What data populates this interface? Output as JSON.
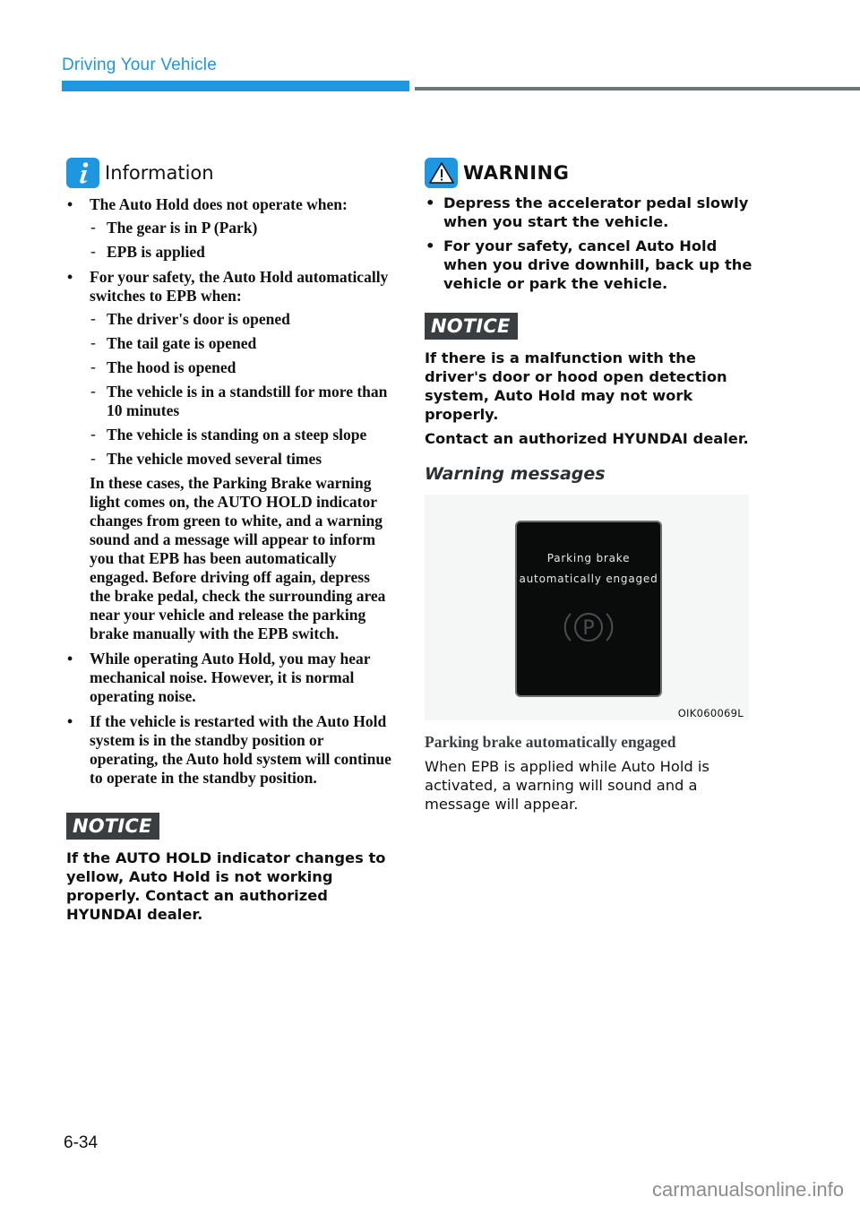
{
  "header": {
    "section_title": "Driving Your Vehicle",
    "accent_color": "#1e96e0",
    "rule_color": "#6d7475"
  },
  "information": {
    "icon": "info-icon",
    "title": "Information",
    "bullets": [
      {
        "text": "The Auto Hold does not operate when:",
        "sub_items": [
          "The gear is in P (Park)",
          "EPB is applied"
        ]
      },
      {
        "text": "For your safety, the Auto Hold automatically switches to EPB when:",
        "sub_items": [
          "The driver's door is opened",
          "The tail gate is opened",
          "The hood is opened",
          "The vehicle is in a standstill for more than 10 minutes",
          "The vehicle is standing on a steep slope",
          "The vehicle moved several times"
        ],
        "follow_text": "In these cases, the Parking Brake warning light comes on, the AUTO HOLD indicator changes from green to white, and a warning sound and a message will appear to inform you that EPB has been automatically engaged. Before driving off again, depress the brake pedal, check the surrounding area near your vehicle and release the parking brake manually with the EPB switch."
      },
      {
        "text": "While operating Auto Hold, you may hear mechanical noise. However, it is normal operating noise."
      },
      {
        "text": "If the vehicle is restarted with the Auto Hold system is in the standby position or operating, the Auto hold system will continue to operate in the standby position."
      }
    ],
    "bullet_glyph": "•",
    "dash_glyph": "-"
  },
  "notice_left": {
    "label": "NOTICE",
    "text": "If the AUTO HOLD indicator changes to yellow, Auto Hold is not working properly. Contact an authorized HYUNDAI dealer."
  },
  "warning": {
    "icon": "warning-triangle-icon",
    "title": "WARNING",
    "bullets": [
      "Depress the accelerator pedal slowly when you start the vehicle.",
      "For your safety, cancel Auto Hold when you drive downhill, back up the vehicle or park the vehicle."
    ]
  },
  "notice_right": {
    "label": "NOTICE",
    "paragraphs": [
      "If there is a malfunction with the driver's door or hood open detection system, Auto Hold may not work properly.",
      "Contact an authorized HYUNDAI dealer."
    ]
  },
  "warning_messages": {
    "section_title": "Warning messages",
    "figure": {
      "display_line1": "Parking brake",
      "display_line2": "automatically engaged",
      "indicator_icon": "parking-brake-icon",
      "indicator_glyph": "P",
      "figure_code": "OIK060069L"
    },
    "sub_heading": "Parking brake automatically engaged",
    "description": "When EPB is applied while Auto Hold is activated, a warning will sound and a message will appear."
  },
  "footer": {
    "page_number": "6-34",
    "watermark": "carmanualsonline.info"
  }
}
